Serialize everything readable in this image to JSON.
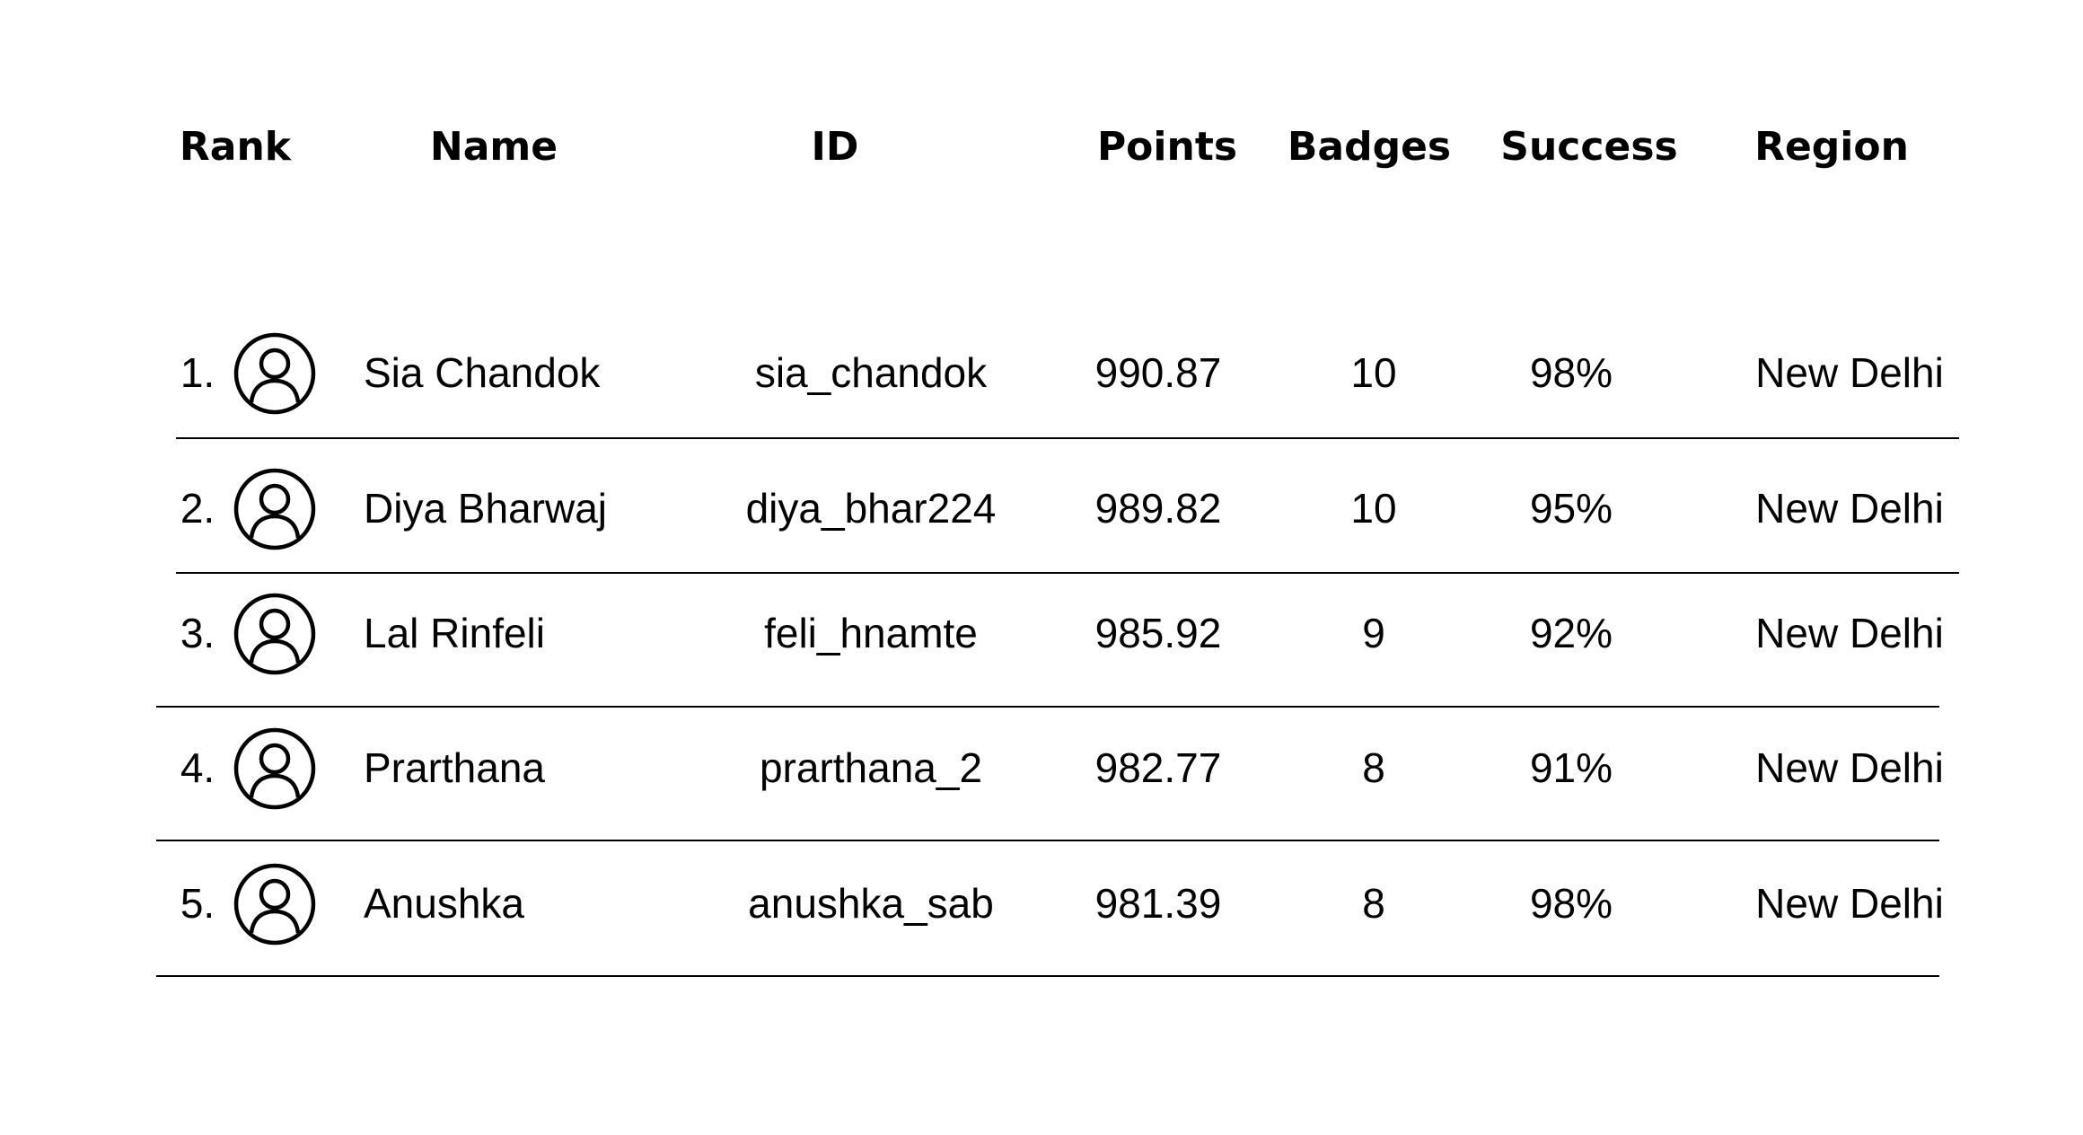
{
  "table": {
    "headers": {
      "rank": "Rank",
      "name": "Name",
      "id": "ID",
      "points": "Points",
      "badges": "Badges",
      "success": "Success",
      "region": "Region"
    },
    "rows": [
      {
        "rank": "1.",
        "avatar_icon": "user-avatar-icon",
        "name": "Sia Chandok",
        "id": "sia_chandok",
        "points": "990.87",
        "badges": "10",
        "success": "98%",
        "region": "New Delhi"
      },
      {
        "rank": "2.",
        "avatar_icon": "user-avatar-icon",
        "name": "Diya Bharwaj",
        "id": "diya_bhar224",
        "points": "989.82",
        "badges": "10",
        "success": "95%",
        "region": "New Delhi"
      },
      {
        "rank": "3.",
        "avatar_icon": "user-avatar-icon",
        "name": "Lal Rinfeli",
        "id": "feli_hnamte",
        "points": "985.92",
        "badges": "9",
        "success": "92%",
        "region": "New Delhi"
      },
      {
        "rank": "4.",
        "avatar_icon": "user-avatar-icon",
        "name": "Prarthana",
        "id": "prarthana_2",
        "points": "982.77",
        "badges": "8",
        "success": "91%",
        "region": "New Delhi"
      },
      {
        "rank": "5.",
        "avatar_icon": "user-avatar-icon",
        "name": "Anushka",
        "id": "anushka_sab",
        "points": "981.39",
        "badges": "8",
        "success": "98%",
        "region": "New Delhi"
      }
    ]
  },
  "colors": {
    "background": "#ffffff",
    "text": "#000000",
    "divider": "#000000"
  }
}
